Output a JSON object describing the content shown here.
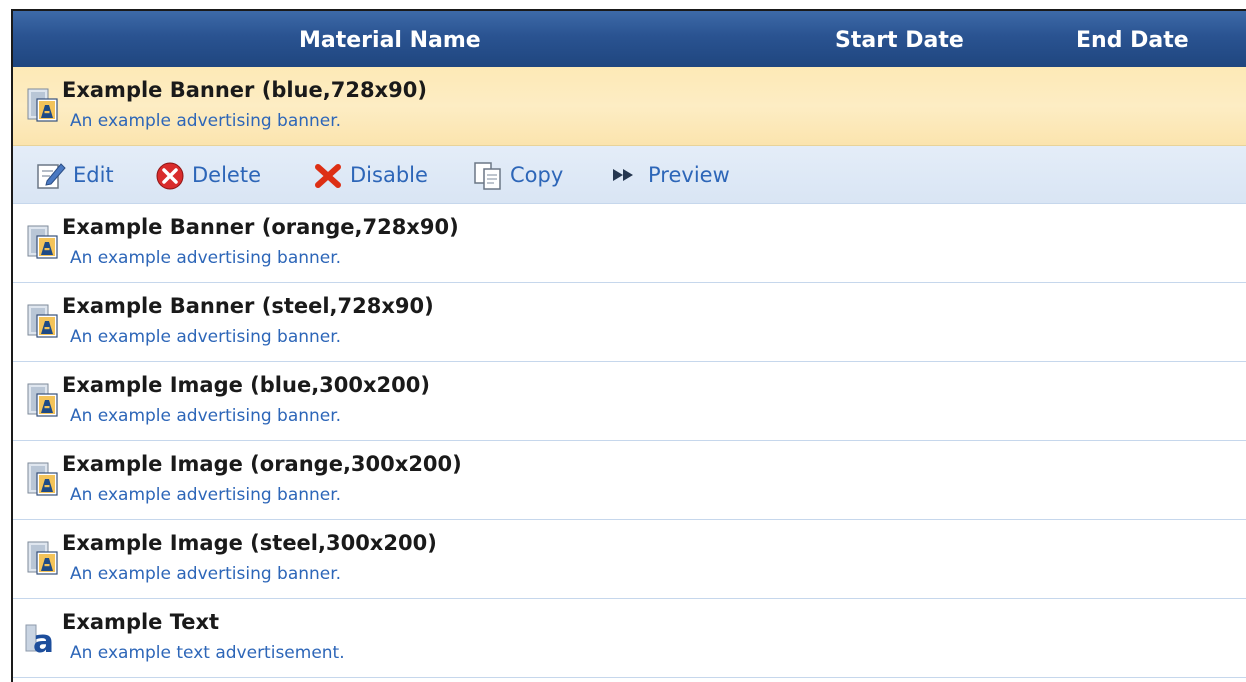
{
  "table": {
    "columns": {
      "material_name": "Material Name",
      "start_date": "Start Date",
      "end_date": "End Date"
    },
    "rows": [
      {
        "title": "Example Banner (blue,728x90)",
        "description": "An example advertising banner.",
        "icon": "image-material-icon",
        "selected": true
      },
      {
        "title": "Example Banner (orange,728x90)",
        "description": "An example advertising banner.",
        "icon": "image-material-icon"
      },
      {
        "title": "Example Banner (steel,728x90)",
        "description": "An example advertising banner.",
        "icon": "image-material-icon"
      },
      {
        "title": "Example Image (blue,300x200)",
        "description": "An example advertising banner.",
        "icon": "image-material-icon"
      },
      {
        "title": "Example Image (orange,300x200)",
        "description": "An example advertising banner.",
        "icon": "image-material-icon"
      },
      {
        "title": "Example Image (steel,300x200)",
        "description": "An example advertising banner.",
        "icon": "image-material-icon"
      },
      {
        "title": "Example Text",
        "description": "An example text advertisement.",
        "icon": "text-material-icon"
      }
    ]
  },
  "actions": {
    "edit": "Edit",
    "delete": "Delete",
    "disable": "Disable",
    "copy": "Copy",
    "preview": "Preview"
  },
  "colors": {
    "header": "#2a5391",
    "selected_row": "#fdedc4",
    "action_bar": "#dde8f6",
    "link": "#2d66b8"
  }
}
